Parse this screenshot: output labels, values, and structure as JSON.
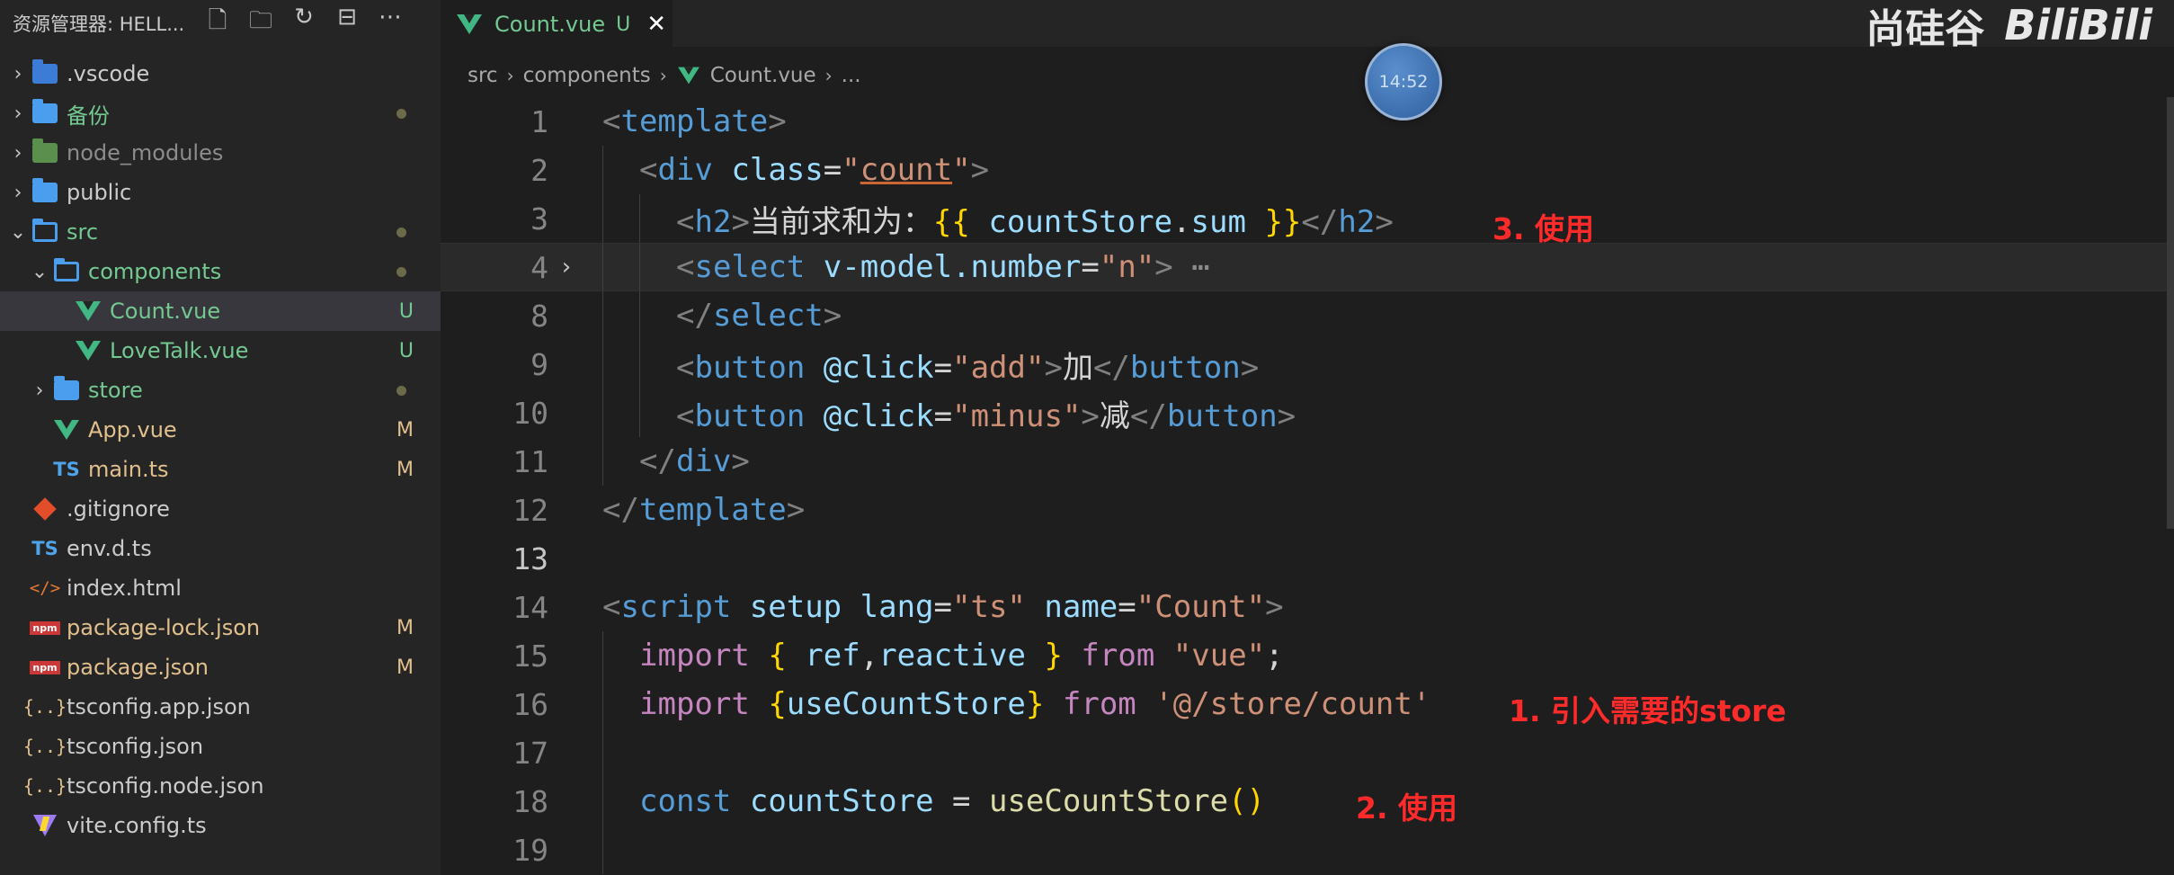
{
  "explorer": {
    "title": "资源管理器: HELL...",
    "actions": [
      "new-file",
      "new-folder",
      "refresh",
      "collapse",
      "more"
    ]
  },
  "tree": [
    {
      "label": ".vscode",
      "type": "folder-vscode",
      "chevron": "closed",
      "level": 0,
      "color": "white",
      "status": ""
    },
    {
      "label": "备份",
      "type": "folder",
      "chevron": "closed",
      "level": 0,
      "color": "green",
      "status": "dot"
    },
    {
      "label": "node_modules",
      "type": "folder-green",
      "chevron": "closed",
      "level": 0,
      "color": "dim",
      "status": ""
    },
    {
      "label": "public",
      "type": "folder",
      "chevron": "closed",
      "level": 0,
      "color": "white",
      "status": ""
    },
    {
      "label": "src",
      "type": "folder-open",
      "chevron": "open",
      "level": 0,
      "color": "green",
      "status": "dot"
    },
    {
      "label": "components",
      "type": "folder-open",
      "chevron": "open",
      "level": 1,
      "color": "green",
      "status": "dot"
    },
    {
      "label": "Count.vue",
      "type": "vue",
      "chevron": "none",
      "level": 2,
      "color": "green",
      "status": "U",
      "selected": true
    },
    {
      "label": "LoveTalk.vue",
      "type": "vue",
      "chevron": "none",
      "level": 2,
      "color": "green",
      "status": "U"
    },
    {
      "label": "store",
      "type": "folder",
      "chevron": "closed",
      "level": 1,
      "color": "green",
      "status": "dot"
    },
    {
      "label": "App.vue",
      "type": "vue",
      "chevron": "none",
      "level": 1,
      "color": "mod",
      "status": "M"
    },
    {
      "label": "main.ts",
      "type": "ts",
      "chevron": "none",
      "level": 1,
      "color": "mod",
      "status": "M"
    },
    {
      "label": ".gitignore",
      "type": "git",
      "chevron": "none",
      "level": 0,
      "color": "white",
      "status": ""
    },
    {
      "label": "env.d.ts",
      "type": "ts",
      "chevron": "none",
      "level": 0,
      "color": "white",
      "status": ""
    },
    {
      "label": "index.html",
      "type": "html",
      "chevron": "none",
      "level": 0,
      "color": "white",
      "status": ""
    },
    {
      "label": "package-lock.json",
      "type": "npm",
      "chevron": "none",
      "level": 0,
      "color": "mod",
      "status": "M"
    },
    {
      "label": "package.json",
      "type": "npm",
      "chevron": "none",
      "level": 0,
      "color": "mod",
      "status": "M"
    },
    {
      "label": "tsconfig.app.json",
      "type": "json",
      "chevron": "none",
      "level": 0,
      "color": "white",
      "status": ""
    },
    {
      "label": "tsconfig.json",
      "type": "json",
      "chevron": "none",
      "level": 0,
      "color": "white",
      "status": ""
    },
    {
      "label": "tsconfig.node.json",
      "type": "json",
      "chevron": "none",
      "level": 0,
      "color": "white",
      "status": ""
    },
    {
      "label": "vite.config.ts",
      "type": "vite",
      "chevron": "none",
      "level": 0,
      "color": "white",
      "status": ""
    }
  ],
  "tab": {
    "label": "Count.vue",
    "status": "U",
    "close": "✕"
  },
  "breadcrumb": {
    "parts": [
      "src",
      "components",
      "Count.vue",
      "..."
    ]
  },
  "code": [
    {
      "n": "1",
      "indent": 0,
      "tokens": [
        [
          "tg",
          "<"
        ],
        [
          "tn",
          "template"
        ],
        [
          "tg",
          ">"
        ]
      ]
    },
    {
      "n": "2",
      "indent": 1,
      "tokens": [
        [
          "tg",
          "<"
        ],
        [
          "tn",
          "div"
        ],
        [
          "pl",
          " "
        ],
        [
          "at",
          "class"
        ],
        [
          "pl",
          "="
        ],
        [
          "st",
          "\""
        ],
        [
          "st-u",
          "count"
        ],
        [
          "st",
          "\""
        ],
        [
          "tg",
          ">"
        ]
      ]
    },
    {
      "n": "3",
      "indent": 2,
      "tokens": [
        [
          "tg",
          "<"
        ],
        [
          "tn",
          "h2"
        ],
        [
          "tg",
          ">"
        ],
        [
          "pl",
          "当前求和为："
        ],
        [
          "br",
          "{{"
        ],
        [
          "pl",
          " "
        ],
        [
          "id",
          "countStore"
        ],
        [
          "pl",
          "."
        ],
        [
          "id",
          "sum"
        ],
        [
          "pl",
          " "
        ],
        [
          "br",
          "}}"
        ],
        [
          "tg",
          "</"
        ],
        [
          "tn",
          "h2"
        ],
        [
          "tg",
          ">"
        ]
      ]
    },
    {
      "n": "4",
      "indent": 2,
      "fold": "›",
      "active": true,
      "tokens": [
        [
          "tg",
          "<"
        ],
        [
          "tn",
          "select"
        ],
        [
          "pl",
          " "
        ],
        [
          "at",
          "v-model.number"
        ],
        [
          "pl",
          "="
        ],
        [
          "st",
          "\"n\""
        ],
        [
          "tg",
          ">"
        ],
        [
          "ex",
          " ⋯"
        ]
      ]
    },
    {
      "n": "8",
      "indent": 2,
      "tokens": [
        [
          "tg",
          "</"
        ],
        [
          "tn",
          "select"
        ],
        [
          "tg",
          ">"
        ]
      ]
    },
    {
      "n": "9",
      "indent": 2,
      "tokens": [
        [
          "tg",
          "<"
        ],
        [
          "tn",
          "button"
        ],
        [
          "pl",
          " "
        ],
        [
          "at",
          "@click"
        ],
        [
          "pl",
          "="
        ],
        [
          "st",
          "\"add\""
        ],
        [
          "tg",
          ">"
        ],
        [
          "pl",
          "加"
        ],
        [
          "tg",
          "</"
        ],
        [
          "tn",
          "button"
        ],
        [
          "tg",
          ">"
        ]
      ]
    },
    {
      "n": "10",
      "indent": 2,
      "tokens": [
        [
          "tg",
          "<"
        ],
        [
          "tn",
          "button"
        ],
        [
          "pl",
          " "
        ],
        [
          "at",
          "@click"
        ],
        [
          "pl",
          "="
        ],
        [
          "st",
          "\"minus\""
        ],
        [
          "tg",
          ">"
        ],
        [
          "pl",
          "减"
        ],
        [
          "tg",
          "</"
        ],
        [
          "tn",
          "button"
        ],
        [
          "tg",
          ">"
        ]
      ]
    },
    {
      "n": "11",
      "indent": 1,
      "tokens": [
        [
          "tg",
          "</"
        ],
        [
          "tn",
          "div"
        ],
        [
          "tg",
          ">"
        ]
      ]
    },
    {
      "n": "12",
      "indent": 0,
      "tokens": [
        [
          "tg",
          "</"
        ],
        [
          "tn",
          "template"
        ],
        [
          "tg",
          ">"
        ]
      ]
    },
    {
      "n": "13",
      "indent": 0,
      "current": true,
      "tokens": []
    },
    {
      "n": "14",
      "indent": 0,
      "tokens": [
        [
          "tg",
          "<"
        ],
        [
          "tn",
          "script"
        ],
        [
          "pl",
          " "
        ],
        [
          "at",
          "setup"
        ],
        [
          "pl",
          " "
        ],
        [
          "at",
          "lang"
        ],
        [
          "pl",
          "="
        ],
        [
          "st",
          "\"ts\""
        ],
        [
          "pl",
          " "
        ],
        [
          "at",
          "name"
        ],
        [
          "pl",
          "="
        ],
        [
          "st",
          "\"Count\""
        ],
        [
          "tg",
          ">"
        ]
      ]
    },
    {
      "n": "15",
      "indent": 1,
      "tokens": [
        [
          "kw",
          "import"
        ],
        [
          "pl",
          " "
        ],
        [
          "br",
          "{"
        ],
        [
          "pl",
          " "
        ],
        [
          "id",
          "ref"
        ],
        [
          "pl",
          ","
        ],
        [
          "id",
          "reactive"
        ],
        [
          "pl",
          " "
        ],
        [
          "br",
          "}"
        ],
        [
          "pl",
          " "
        ],
        [
          "kw",
          "from"
        ],
        [
          "pl",
          " "
        ],
        [
          "st",
          "\"vue\""
        ],
        [
          "pl",
          ";"
        ]
      ]
    },
    {
      "n": "16",
      "indent": 1,
      "tokens": [
        [
          "kw",
          "import"
        ],
        [
          "pl",
          " "
        ],
        [
          "br",
          "{"
        ],
        [
          "id",
          "useCountStore"
        ],
        [
          "br",
          "}"
        ],
        [
          "pl",
          " "
        ],
        [
          "kw",
          "from"
        ],
        [
          "pl",
          " "
        ],
        [
          "st",
          "'@/store/count'"
        ]
      ]
    },
    {
      "n": "17",
      "indent": 1,
      "tokens": []
    },
    {
      "n": "18",
      "indent": 1,
      "tokens": [
        [
          "bl",
          "const"
        ],
        [
          "pl",
          " "
        ],
        [
          "id",
          "countStore"
        ],
        [
          "pl",
          " = "
        ],
        [
          "fn",
          "useCountStore"
        ],
        [
          "br",
          "()"
        ]
      ]
    },
    {
      "n": "19",
      "indent": 1,
      "tokens": []
    }
  ],
  "annotations": {
    "a3": "3. 使用",
    "a1": "1. 引入需要的store",
    "a2": "2. 使用"
  },
  "overlay": {
    "time": "14:52",
    "brand": "尚硅谷",
    "site": "BiliBili"
  }
}
